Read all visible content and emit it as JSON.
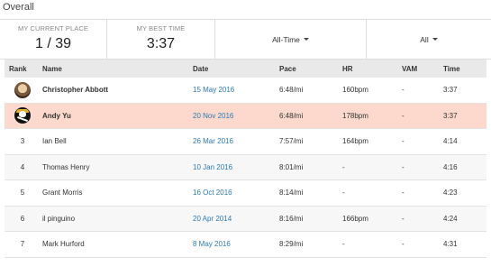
{
  "page": {
    "title": "Overall"
  },
  "stats": {
    "current_place_label": "MY CURRENT PLACE",
    "current_place_value": "1 / 39",
    "best_time_label": "MY BEST TIME",
    "best_time_value": "3:37"
  },
  "filters": {
    "period": "All-Time",
    "scope": "All"
  },
  "table": {
    "headers": {
      "rank": "Rank",
      "name": "Name",
      "date": "Date",
      "pace": "Pace",
      "hr": "HR",
      "vam": "VAM",
      "time": "Time"
    },
    "rows": [
      {
        "rank": "",
        "avatar": "athlete-photo",
        "name": "Christopher Abbott",
        "date": "15 May 2016",
        "pace": "6:48/mi",
        "hr": "160bpm",
        "vam": "-",
        "time": "3:37"
      },
      {
        "rank": "",
        "avatar": "skull-crossbones-avatar",
        "name": "Andy Yu",
        "date": "20 Nov 2016",
        "pace": "6:48/mi",
        "hr": "178bpm",
        "vam": "-",
        "time": "3:37"
      },
      {
        "rank": "3",
        "name": "Ian Bell",
        "date": "26 Mar 2016",
        "pace": "7:57/mi",
        "hr": "164bpm",
        "vam": "-",
        "time": "4:14"
      },
      {
        "rank": "4",
        "name": "Thomas Henry",
        "date": "10 Jan 2016",
        "pace": "8:01/mi",
        "hr": "-",
        "vam": "-",
        "time": "4:16"
      },
      {
        "rank": "5",
        "name": "Grant Morris",
        "date": "16 Oct 2016",
        "pace": "8:14/mi",
        "hr": "-",
        "vam": "-",
        "time": "4:23"
      },
      {
        "rank": "6",
        "name": "il pinguino",
        "date": "20 Apr 2014",
        "pace": "8:16/mi",
        "hr": "166bpm",
        "vam": "-",
        "time": "4:24"
      },
      {
        "rank": "7",
        "name": "Mark Hurford",
        "date": "8 May 2016",
        "pace": "8:29/mi",
        "hr": "-",
        "vam": "-",
        "time": "4:31"
      }
    ]
  }
}
